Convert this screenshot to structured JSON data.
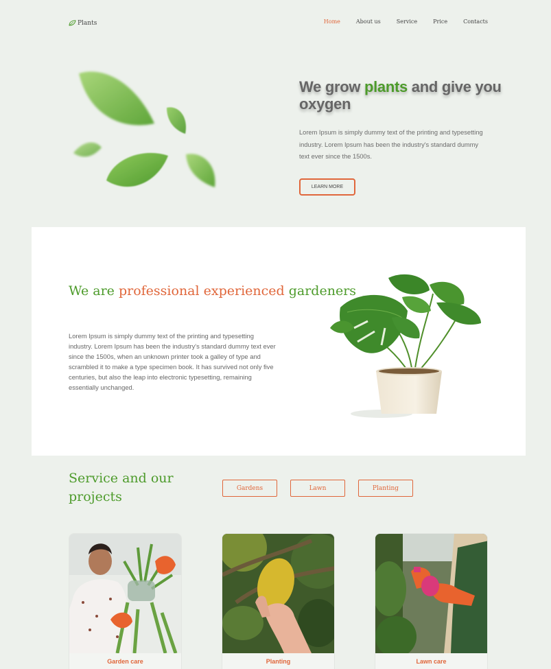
{
  "nav": {
    "logo": "Plants",
    "items": [
      {
        "label": "Home",
        "active": true
      },
      {
        "label": "About us",
        "active": false
      },
      {
        "label": "Service",
        "active": false
      },
      {
        "label": "Price",
        "active": false
      },
      {
        "label": "Contacts",
        "active": false
      }
    ]
  },
  "hero": {
    "title_part1": "We grow ",
    "title_highlight": "plants",
    "title_part2": " and give you oxygen",
    "text": "Lorem Ipsum is simply dummy text of the printing and typesetting industry. Lorem Ipsum has been the industry's standard dummy text ever since the 1500s.",
    "button": "LEARN MORE"
  },
  "about": {
    "title_part1": "We are ",
    "title_highlight": "professional experienced",
    "title_part2": " gardeners",
    "text": "Lorem Ipsum is simply dummy text of the printing and typesetting industry. Lorem Ipsum has been the industry's standard dummy text ever since the 1500s, when an unknown printer took a galley of type and scrambled it to make a type specimen book. It has survived not only five centuries, but also the leap into electronic typesetting, remaining essentially unchanged."
  },
  "services": {
    "title": "Service and our projects",
    "filters": [
      "Gardens",
      "Lawn",
      "Planting"
    ],
    "cards": [
      {
        "label": "Garden care"
      },
      {
        "label": "Planting"
      },
      {
        "label": "Lawn care"
      }
    ]
  },
  "colors": {
    "background": "#edf1ec",
    "green": "#4d9b2b",
    "orange": "#e0663a"
  }
}
